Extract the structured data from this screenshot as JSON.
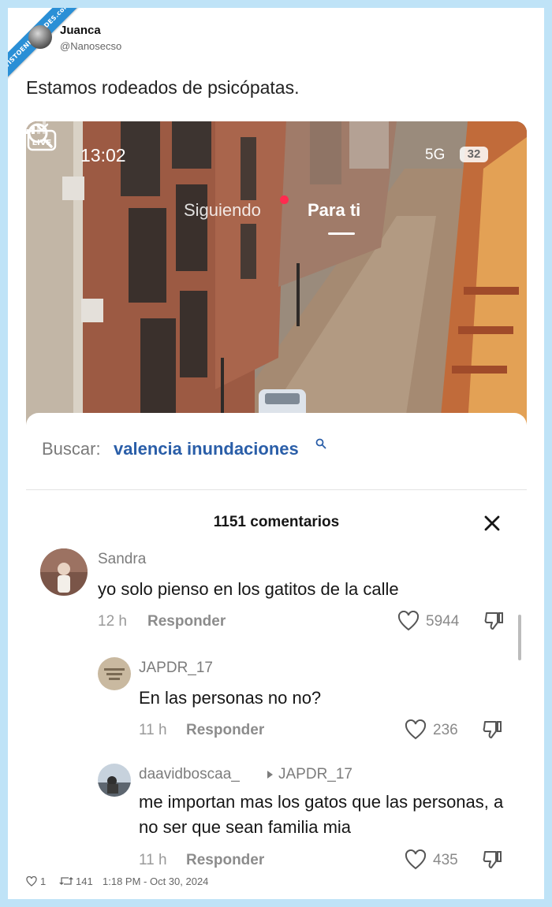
{
  "watermark": {
    "text": "VISTOENLASREDES.com"
  },
  "tweet": {
    "author_name": "Juanca",
    "author_handle": "@Nanosecso",
    "text": "Estamos rodeados de psicópatas."
  },
  "video": {
    "status_time": "13:02",
    "network": "5G",
    "battery": "32",
    "nav": {
      "following": "Siguiendo",
      "for_you": "Para ti"
    }
  },
  "search": {
    "label": "Buscar:",
    "query": "valencia inundaciones"
  },
  "comments": {
    "count_label": "1151 comentarios",
    "items": [
      {
        "user": "Sandra",
        "text": "yo solo pienso en los gatitos de la calle",
        "time": "12 h",
        "reply": "Responder",
        "likes": "5944"
      },
      {
        "user": "JAPDR_17",
        "text": "En las personas no no?",
        "time": "11 h",
        "reply": "Responder",
        "likes": "236"
      },
      {
        "user": "daavidboscaa_",
        "reply_to": "JAPDR_17",
        "text": "me importan mas los gatos que las personas, a no ser que sean familia mia",
        "time": "11 h",
        "reply": "Responder",
        "likes": "435"
      }
    ]
  },
  "footer": {
    "likes": "1",
    "retweets": "141",
    "timestamp": "1:18 PM - Oct 30, 2024"
  },
  "colors": {
    "accent": "#2a5ea8",
    "brand_ribbon": "#2a8fd6",
    "live_dot": "#ff2b4f"
  }
}
